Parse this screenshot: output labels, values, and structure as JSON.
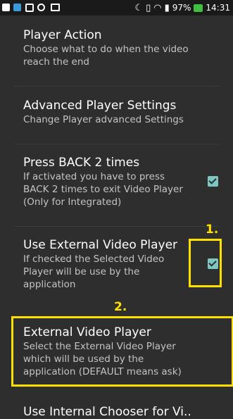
{
  "status_bar": {
    "battery_percent": "97%",
    "time": "14:31",
    "icons": [
      "chat-icon",
      "app-icon",
      "gallery-icon",
      "cast-icon",
      "mail-icon",
      "moon-icon",
      "vibrate-icon",
      "wifi-icon",
      "battery-icon",
      "charging-battery-icon"
    ]
  },
  "settings": [
    {
      "title": "Player Action",
      "summary": "Choose what to do when the video reach the end"
    },
    {
      "title": "Advanced Player Settings",
      "summary": "Change Player advanced Settings"
    },
    {
      "title": "Press BACK 2 times",
      "summary": "If activated you have to press BACK 2 times to exit Video Player (Only for Integrated)",
      "checked": true
    },
    {
      "title": "Use External Video Player",
      "summary": "If checked the Selected Video Player will be use by the application",
      "checked": true
    },
    {
      "title": "External Video Player",
      "summary": "Select the External Video Player which will be used by the application (DEFAULT means ask)"
    },
    {
      "title": "Use Internal Chooser for Vi.."
    }
  ],
  "annotations": {
    "label_1": "1.",
    "label_2": "2.",
    "highlight_color": "#ffe000"
  },
  "colors": {
    "background": "#2e2e2e",
    "checkbox": "#7ec6c2",
    "title_text": "#ffffff",
    "summary_text": "#c4c4c4"
  }
}
